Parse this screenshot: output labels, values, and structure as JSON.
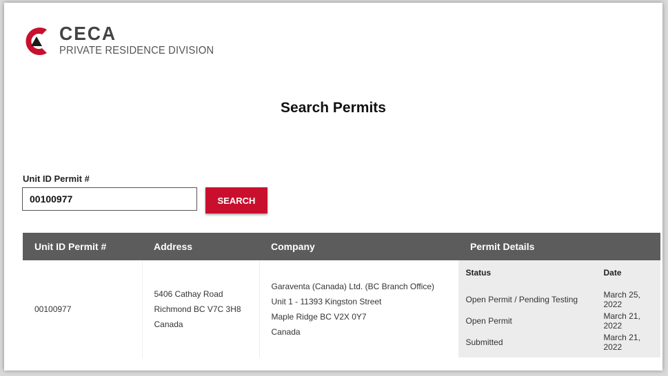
{
  "brand": {
    "name": "CECA",
    "subtitle": "PRIVATE RESIDENCE DIVISION",
    "colors": {
      "accent": "#c8102e",
      "dark": "#333333"
    }
  },
  "page_title": "Search Permits",
  "search": {
    "label": "Unit ID Permit #",
    "value": "00100977",
    "button_label": "SEARCH"
  },
  "results": {
    "headers": [
      "Unit ID Permit #",
      "Address",
      "Company",
      "Permit Details"
    ],
    "row": {
      "unit_id": "00100977",
      "address": [
        "5406 Cathay Road",
        "Richmond BC V7C 3H8",
        "Canada"
      ],
      "company": [
        "Garaventa (Canada) Ltd. (BC Branch Office)",
        "Unit 1 - 11393 Kingston Street",
        "Maple Ridge BC V2X 0Y7",
        "Canada"
      ],
      "details": {
        "status_header": "Status",
        "date_header": "Date",
        "entries": [
          {
            "status": "Open Permit / Pending Testing",
            "date": "March 25, 2022"
          },
          {
            "status": "Open Permit",
            "date": "March 21, 2022"
          },
          {
            "status": "Submitted",
            "date": "March 21, 2022"
          }
        ]
      }
    }
  }
}
